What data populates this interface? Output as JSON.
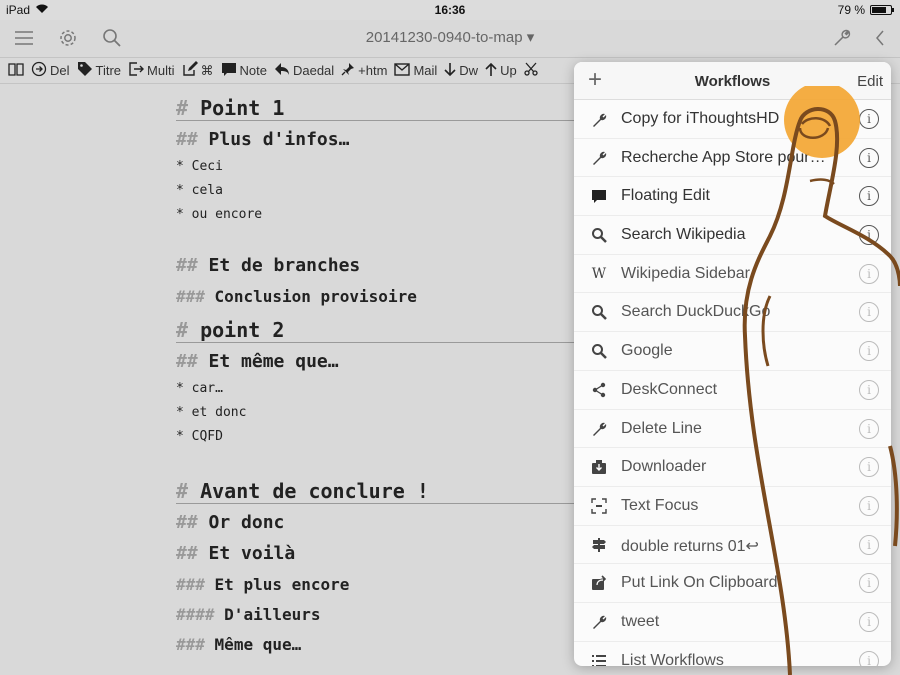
{
  "status_bar": {
    "device": "iPad",
    "time": "16:36",
    "battery_text": "79 %",
    "battery_level": 0.79
  },
  "nav_bar": {
    "title": "20141230-0940-to-map ▾"
  },
  "toolbar": {
    "items": [
      {
        "icon": "book-icon",
        "label": ""
      },
      {
        "icon": "arrow-circle-icon",
        "label": "Del"
      },
      {
        "icon": "tag-icon",
        "label": "Titre"
      },
      {
        "icon": "export-icon",
        "label": "Multi"
      },
      {
        "icon": "edit-icon",
        "label": "⌘"
      },
      {
        "icon": "speech-bubble-icon",
        "label": "Note"
      },
      {
        "icon": "back-arrow-icon",
        "label": "Daedal"
      },
      {
        "icon": "pin-icon",
        "label": "+htm"
      },
      {
        "icon": "mail-icon",
        "label": "Mail"
      },
      {
        "icon": "arrow-down-icon",
        "label": "Dw"
      },
      {
        "icon": "arrow-up-icon",
        "label": "Up"
      },
      {
        "icon": "scissors-icon",
        "label": ""
      }
    ]
  },
  "editor": {
    "lines": [
      {
        "hash": "#",
        "text": "Point 1"
      },
      {
        "hash": "##",
        "text": "Plus d'infos…"
      },
      {
        "hash": "*",
        "text": "Ceci"
      },
      {
        "hash": "*",
        "text": "cela"
      },
      {
        "hash": "*",
        "text": "ou encore"
      },
      {
        "hash": "##",
        "text": "Et de branches"
      },
      {
        "hash": "###",
        "text": "Conclusion provisoire"
      },
      {
        "hash": "#",
        "text": "point 2"
      },
      {
        "hash": "##",
        "text": "Et même que…"
      },
      {
        "hash": "*",
        "text": "car…"
      },
      {
        "hash": "*",
        "text": "et donc"
      },
      {
        "hash": "*",
        "text": "CQFD"
      },
      {
        "hash": "#",
        "text": "Avant de conclure !"
      },
      {
        "hash": "##",
        "text": "Or donc"
      },
      {
        "hash": "##",
        "text": "Et voilà"
      },
      {
        "hash": "###",
        "text": "Et plus encore"
      },
      {
        "hash": "####",
        "text": "D'ailleurs"
      },
      {
        "hash": "###",
        "text": "Même que…"
      }
    ]
  },
  "workflows": {
    "add_symbol": "+",
    "title": "Workflows",
    "edit_label": "Edit",
    "info_symbol": "i",
    "items": [
      {
        "icon": "wrench-icon",
        "label": "Copy for iThoughtsHD"
      },
      {
        "icon": "wrench-icon",
        "label": "Recherche App Store pour…"
      },
      {
        "icon": "speech-bubble-icon",
        "label": "Floating Edit"
      },
      {
        "icon": "magnifier-icon",
        "label": "Search Wikipedia"
      },
      {
        "icon": "wikipedia-icon",
        "label": "Wikipedia Sidebar"
      },
      {
        "icon": "magnifier-icon",
        "label": "Search DuckDuckGo"
      },
      {
        "icon": "magnifier-icon",
        "label": "Google"
      },
      {
        "icon": "share-icon",
        "label": "DeskConnect"
      },
      {
        "icon": "wrench-icon",
        "label": "Delete Line"
      },
      {
        "icon": "download-icon",
        "label": "Downloader"
      },
      {
        "icon": "focus-icon",
        "label": "Text Focus"
      },
      {
        "icon": "signpost-icon",
        "label": "double returns 01↩"
      },
      {
        "icon": "share-box-icon",
        "label": "Put Link On Clipboard"
      },
      {
        "icon": "wrench-icon",
        "label": "tweet"
      },
      {
        "icon": "list-icon",
        "label": "List Workflows"
      }
    ]
  },
  "colors": {
    "background": "#d9d9d9",
    "popover": "#fbfbfb",
    "touch_indicator": "#f3a633",
    "finger_outline": "#7a4a1e"
  }
}
